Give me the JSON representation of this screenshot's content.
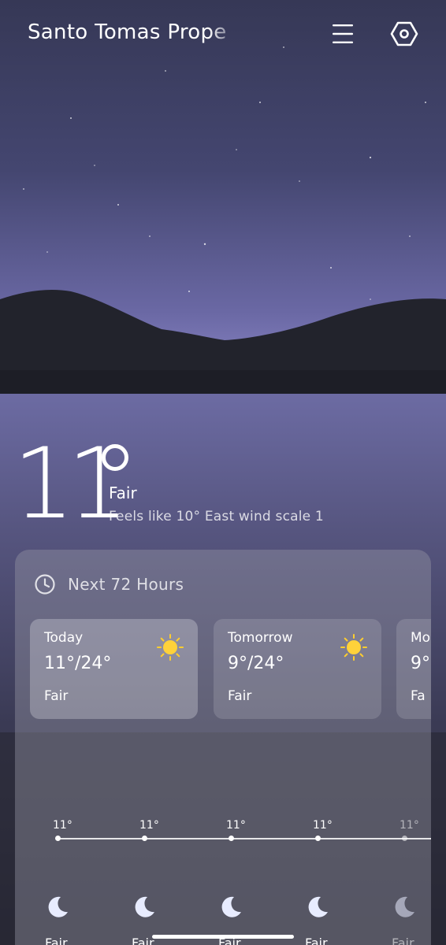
{
  "location": "Santo Tomas Prope",
  "current": {
    "temperature": "11",
    "condition": "Fair",
    "feels_like": "Feels like 10° East wind scale 1"
  },
  "forecast": {
    "title": "Next 72 Hours",
    "days": [
      {
        "name": "Today",
        "range": "11°/24°",
        "condition": "Fair",
        "icon": "sun-icon"
      },
      {
        "name": "Tomorrow",
        "range": "9°/24°",
        "condition": "Fair",
        "icon": "sun-icon"
      },
      {
        "name": "Mo",
        "range": "9°",
        "condition": "Fa",
        "icon": "sun-icon"
      }
    ],
    "hourly": [
      {
        "temp": "11°",
        "condition": "Fair",
        "icon": "moon-icon"
      },
      {
        "temp": "11°",
        "condition": "Fair",
        "icon": "moon-icon"
      },
      {
        "temp": "11°",
        "condition": "Fair",
        "icon": "moon-icon"
      },
      {
        "temp": "11°",
        "condition": "Fair",
        "icon": "moon-icon"
      },
      {
        "temp": "11°",
        "condition": "Fair",
        "icon": "moon-icon"
      }
    ]
  },
  "icons": {
    "menu": "menu-icon",
    "settings": "settings-hexagon-icon",
    "clock": "clock-icon"
  },
  "colors": {
    "sky_top": "#3b3d63",
    "sky_bottom": "#6d6aa8",
    "sun": "#ffd23a"
  }
}
